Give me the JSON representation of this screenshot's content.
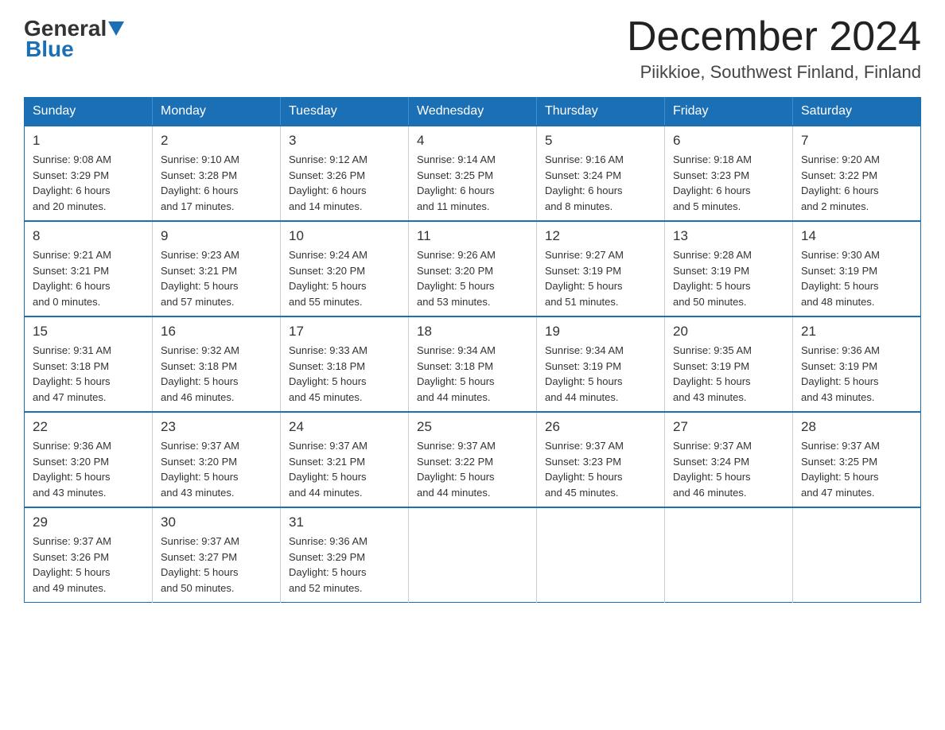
{
  "header": {
    "logo_general": "General",
    "logo_blue": "Blue",
    "month_title": "December 2024",
    "location": "Piikkioe, Southwest Finland, Finland"
  },
  "weekdays": [
    "Sunday",
    "Monday",
    "Tuesday",
    "Wednesday",
    "Thursday",
    "Friday",
    "Saturday"
  ],
  "weeks": [
    [
      {
        "day": "1",
        "info": "Sunrise: 9:08 AM\nSunset: 3:29 PM\nDaylight: 6 hours\nand 20 minutes."
      },
      {
        "day": "2",
        "info": "Sunrise: 9:10 AM\nSunset: 3:28 PM\nDaylight: 6 hours\nand 17 minutes."
      },
      {
        "day": "3",
        "info": "Sunrise: 9:12 AM\nSunset: 3:26 PM\nDaylight: 6 hours\nand 14 minutes."
      },
      {
        "day": "4",
        "info": "Sunrise: 9:14 AM\nSunset: 3:25 PM\nDaylight: 6 hours\nand 11 minutes."
      },
      {
        "day": "5",
        "info": "Sunrise: 9:16 AM\nSunset: 3:24 PM\nDaylight: 6 hours\nand 8 minutes."
      },
      {
        "day": "6",
        "info": "Sunrise: 9:18 AM\nSunset: 3:23 PM\nDaylight: 6 hours\nand 5 minutes."
      },
      {
        "day": "7",
        "info": "Sunrise: 9:20 AM\nSunset: 3:22 PM\nDaylight: 6 hours\nand 2 minutes."
      }
    ],
    [
      {
        "day": "8",
        "info": "Sunrise: 9:21 AM\nSunset: 3:21 PM\nDaylight: 6 hours\nand 0 minutes."
      },
      {
        "day": "9",
        "info": "Sunrise: 9:23 AM\nSunset: 3:21 PM\nDaylight: 5 hours\nand 57 minutes."
      },
      {
        "day": "10",
        "info": "Sunrise: 9:24 AM\nSunset: 3:20 PM\nDaylight: 5 hours\nand 55 minutes."
      },
      {
        "day": "11",
        "info": "Sunrise: 9:26 AM\nSunset: 3:20 PM\nDaylight: 5 hours\nand 53 minutes."
      },
      {
        "day": "12",
        "info": "Sunrise: 9:27 AM\nSunset: 3:19 PM\nDaylight: 5 hours\nand 51 minutes."
      },
      {
        "day": "13",
        "info": "Sunrise: 9:28 AM\nSunset: 3:19 PM\nDaylight: 5 hours\nand 50 minutes."
      },
      {
        "day": "14",
        "info": "Sunrise: 9:30 AM\nSunset: 3:19 PM\nDaylight: 5 hours\nand 48 minutes."
      }
    ],
    [
      {
        "day": "15",
        "info": "Sunrise: 9:31 AM\nSunset: 3:18 PM\nDaylight: 5 hours\nand 47 minutes."
      },
      {
        "day": "16",
        "info": "Sunrise: 9:32 AM\nSunset: 3:18 PM\nDaylight: 5 hours\nand 46 minutes."
      },
      {
        "day": "17",
        "info": "Sunrise: 9:33 AM\nSunset: 3:18 PM\nDaylight: 5 hours\nand 45 minutes."
      },
      {
        "day": "18",
        "info": "Sunrise: 9:34 AM\nSunset: 3:18 PM\nDaylight: 5 hours\nand 44 minutes."
      },
      {
        "day": "19",
        "info": "Sunrise: 9:34 AM\nSunset: 3:19 PM\nDaylight: 5 hours\nand 44 minutes."
      },
      {
        "day": "20",
        "info": "Sunrise: 9:35 AM\nSunset: 3:19 PM\nDaylight: 5 hours\nand 43 minutes."
      },
      {
        "day": "21",
        "info": "Sunrise: 9:36 AM\nSunset: 3:19 PM\nDaylight: 5 hours\nand 43 minutes."
      }
    ],
    [
      {
        "day": "22",
        "info": "Sunrise: 9:36 AM\nSunset: 3:20 PM\nDaylight: 5 hours\nand 43 minutes."
      },
      {
        "day": "23",
        "info": "Sunrise: 9:37 AM\nSunset: 3:20 PM\nDaylight: 5 hours\nand 43 minutes."
      },
      {
        "day": "24",
        "info": "Sunrise: 9:37 AM\nSunset: 3:21 PM\nDaylight: 5 hours\nand 44 minutes."
      },
      {
        "day": "25",
        "info": "Sunrise: 9:37 AM\nSunset: 3:22 PM\nDaylight: 5 hours\nand 44 minutes."
      },
      {
        "day": "26",
        "info": "Sunrise: 9:37 AM\nSunset: 3:23 PM\nDaylight: 5 hours\nand 45 minutes."
      },
      {
        "day": "27",
        "info": "Sunrise: 9:37 AM\nSunset: 3:24 PM\nDaylight: 5 hours\nand 46 minutes."
      },
      {
        "day": "28",
        "info": "Sunrise: 9:37 AM\nSunset: 3:25 PM\nDaylight: 5 hours\nand 47 minutes."
      }
    ],
    [
      {
        "day": "29",
        "info": "Sunrise: 9:37 AM\nSunset: 3:26 PM\nDaylight: 5 hours\nand 49 minutes."
      },
      {
        "day": "30",
        "info": "Sunrise: 9:37 AM\nSunset: 3:27 PM\nDaylight: 5 hours\nand 50 minutes."
      },
      {
        "day": "31",
        "info": "Sunrise: 9:36 AM\nSunset: 3:29 PM\nDaylight: 5 hours\nand 52 minutes."
      },
      {
        "day": "",
        "info": ""
      },
      {
        "day": "",
        "info": ""
      },
      {
        "day": "",
        "info": ""
      },
      {
        "day": "",
        "info": ""
      }
    ]
  ]
}
